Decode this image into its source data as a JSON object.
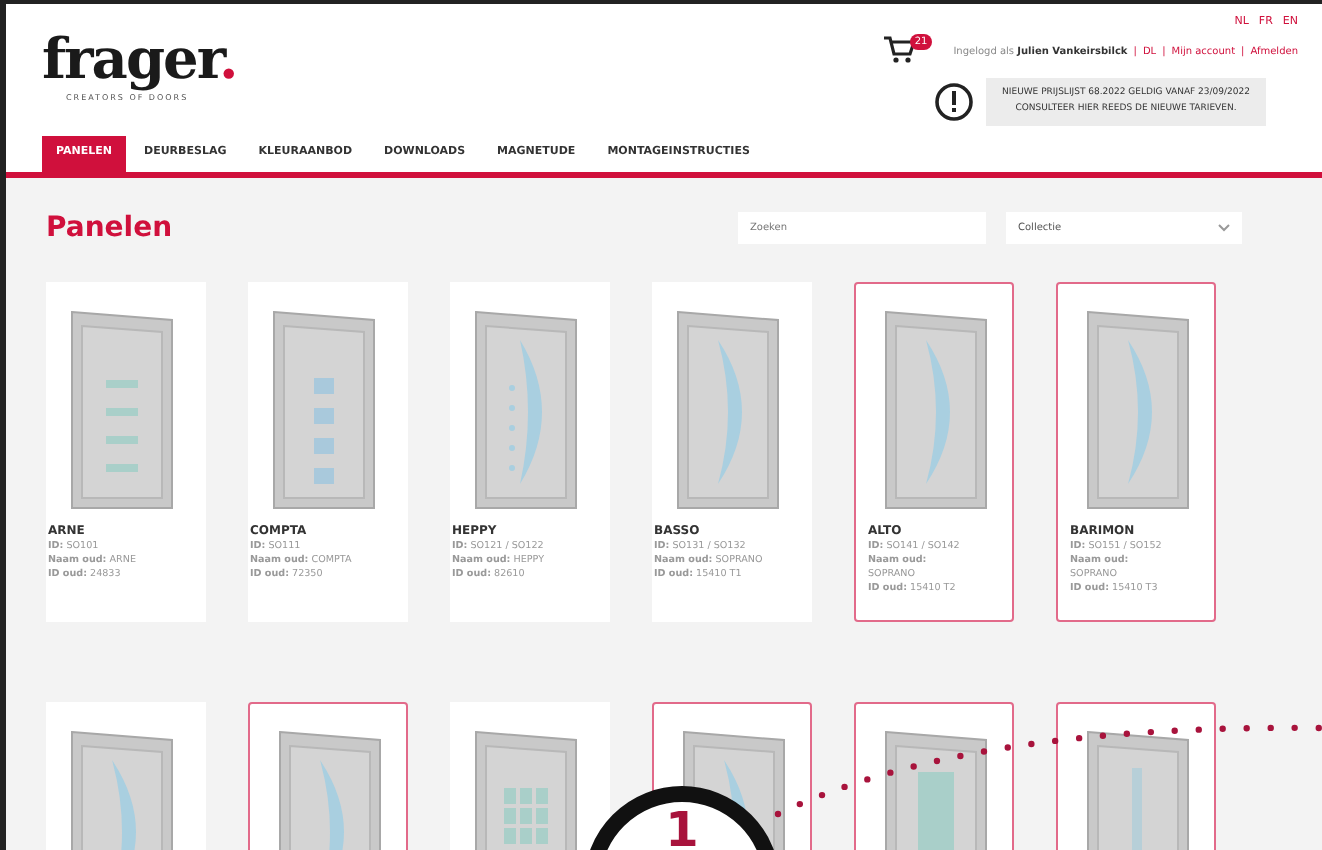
{
  "header": {
    "logo": "frager",
    "logo_dot": ".",
    "tagline": "CREATORS OF DOORS",
    "languages": [
      "NL",
      "FR",
      "EN"
    ],
    "cart_count": "21",
    "user": {
      "prefix": "Ingelogd als",
      "name": "Julien Vankeirsbilck",
      "links": [
        "DL",
        "Mijn account",
        "Afmelden"
      ],
      "separator": "|"
    },
    "notice": [
      "NIEUWE PRIJSLIJST 68.2022 GELDIG VANAF 23/09/2022",
      "CONSULTEER HIER REEDS DE NIEUWE TARIEVEN."
    ]
  },
  "tabs": [
    {
      "label": "PANELEN",
      "selected": true
    },
    {
      "label": "DEURBESLAG",
      "selected": false
    },
    {
      "label": "KLEURAANBOD",
      "selected": false
    },
    {
      "label": "DOWNLOADS",
      "selected": false
    },
    {
      "label": "MAGNETUDE",
      "selected": false
    },
    {
      "label": "MONTAGEINSTRUCTIES",
      "selected": false
    }
  ],
  "page_title": "Panelen",
  "search": {
    "placeholder": "Zoeken"
  },
  "filter": {
    "value": "Collectie"
  },
  "panels": [
    {
      "kind": "bars",
      "selected": false,
      "name": "ARNE",
      "lines": [
        "**ID:** SO101",
        "**Naam oud:** ARNE",
        "**ID oud:** 24833"
      ]
    },
    {
      "kind": "squares",
      "selected": false,
      "name": "COMPTA",
      "lines": [
        "**ID:** SO111",
        "**Naam oud:** COMPTA",
        "**ID oud:** 72350"
      ]
    },
    {
      "kind": "dotarc",
      "selected": false,
      "name": "HEPPY",
      "lines": [
        "**ID:** SO121 / SO122",
        "**Naam oud:** HEPPY",
        "**ID oud:** 82610"
      ]
    },
    {
      "kind": "arc",
      "selected": false,
      "name": "BASSO",
      "lines": [
        "**ID:** SO131 / SO132",
        "**Naam oud:** SOPRANO",
        "**ID oud:** 15410 T1"
      ]
    },
    {
      "kind": "arc",
      "selected": true,
      "name": "ALTO",
      "lines": [
        "**ID:** SO141 / SO142",
        "**Naam oud:**",
        "SOPRANO",
        "**ID oud:** 15410 T2"
      ]
    },
    {
      "kind": "arc",
      "selected": true,
      "name": "BARIMON",
      "lines": [
        "**ID:** SO151 / SO152",
        "**Naam oud:**",
        "SOPRANO",
        "**ID oud:** 15410 T3"
      ]
    },
    {
      "kind": "arc",
      "selected": false
    },
    {
      "kind": "arc",
      "selected": true
    },
    {
      "kind": "grid",
      "selected": false
    },
    {
      "kind": "arc",
      "selected": true
    },
    {
      "kind": "rect",
      "selected": true
    },
    {
      "kind": "slit",
      "selected": true
    }
  ],
  "callout": {
    "number": "1"
  }
}
